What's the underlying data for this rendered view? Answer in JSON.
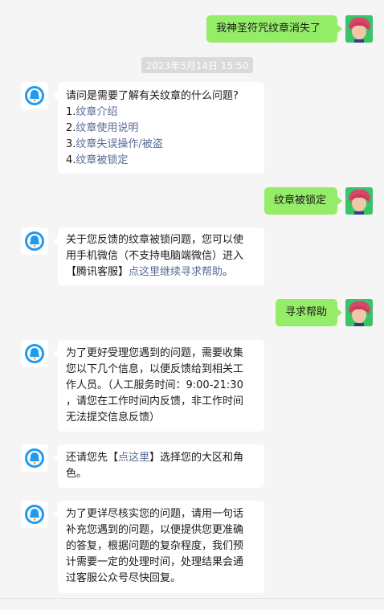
{
  "timestamp": "2023年5月14日 15:50",
  "messages": {
    "m1": "我神圣符咒纹章消失了",
    "m2": {
      "intro": "请问是需要了解有关纹章的什么问题?",
      "options": [
        {
          "num": "1.",
          "link": "纹章介绍"
        },
        {
          "num": "2.",
          "link": "纹章使用说明"
        },
        {
          "num": "3.",
          "link": "纹章失误操作/被盗"
        },
        {
          "num": "4.",
          "link": "纹章被锁定"
        }
      ]
    },
    "m3": "纹章被锁定",
    "m4": {
      "line1": "关于您反馈的纹章被锁问题，您可以使",
      "line2": "用手机微信（不支持电脑端微信）进入",
      "line3_pre": "【腾讯客服】",
      "line3_link": "点这里继续寻求帮助",
      "line3_post": "。"
    },
    "m5": "寻求帮助",
    "m6": [
      "为了更好受理您遇到的问题，需要收集",
      "您以下几个信息，以便反馈给到相关工",
      "作人员。（人工服务时间：9:00-21:30",
      "，请您在工作时间内反馈，非工作时间",
      "无法提交信息反馈）"
    ],
    "m7": {
      "pre": "还请您先【",
      "link": "点这里",
      "post": "】选择您的大区和角",
      "line2": "色。"
    },
    "m8": [
      "为了更详尽核实您的问题，请用一句话",
      "补充您遇到的问题，以便提供您更准确",
      "的答复，根据问题的复杂程度，我们预",
      "计需要一定的处理时间，处理结果会通",
      "过客服公众号尽快回复。"
    ]
  }
}
